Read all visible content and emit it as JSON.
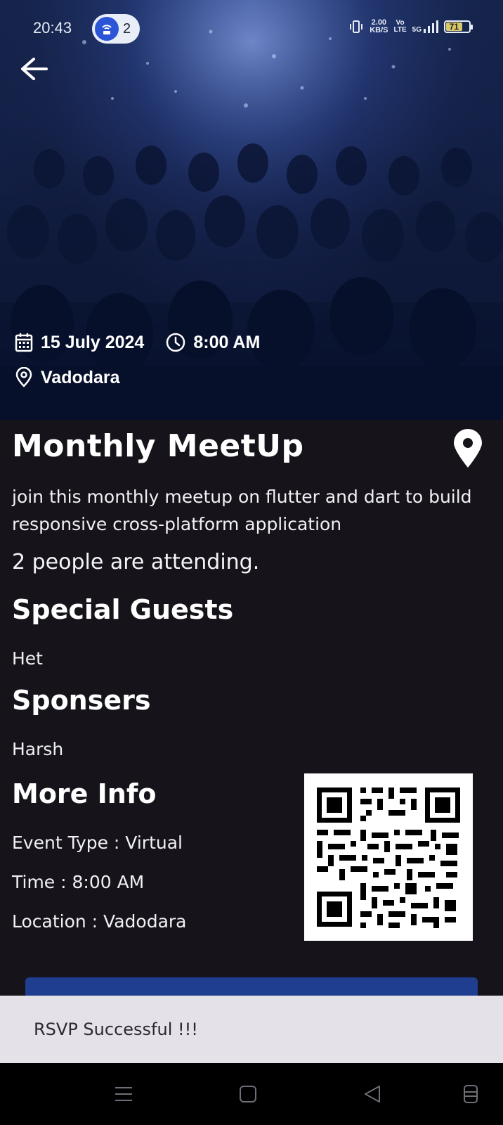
{
  "status_bar": {
    "time": "20:43",
    "hotspot_count": "2",
    "net_speed_value": "2.00",
    "net_speed_unit": "KB/S",
    "volte_top": "Vo",
    "volte_bottom": "LTE",
    "network": "5G",
    "battery": "71"
  },
  "hero": {
    "date": "15 July 2024",
    "time": "8:00 AM",
    "location": "Vadodara"
  },
  "event": {
    "title": "Monthly MeetUp",
    "description": "join this monthly meetup on flutter and dart to build responsive cross-platform application",
    "attending": "2 people are attending.",
    "special_guests_heading": "Special Guests",
    "special_guests": "Het",
    "sponsors_heading": "Sponsers",
    "sponsors": "Harsh",
    "more_info_heading": "More Info",
    "event_type": "Event Type : Virtual",
    "info_time": "Time : 8:00 AM",
    "info_location": "Location : Vadodara"
  },
  "snackbar": {
    "message": "RSVP Successful !!!"
  },
  "colors": {
    "background": "#16141a",
    "button": "#1f3e8f",
    "snackbar": "#e5e1e9",
    "accent_blue": "#2b55d6"
  },
  "icons": [
    "back-arrow-icon",
    "calendar-icon",
    "clock-icon",
    "location-pin-icon",
    "map-pin-icon",
    "qr-code",
    "menu-icon",
    "home-square-icon",
    "back-triangle-icon",
    "rotate-icon"
  ]
}
